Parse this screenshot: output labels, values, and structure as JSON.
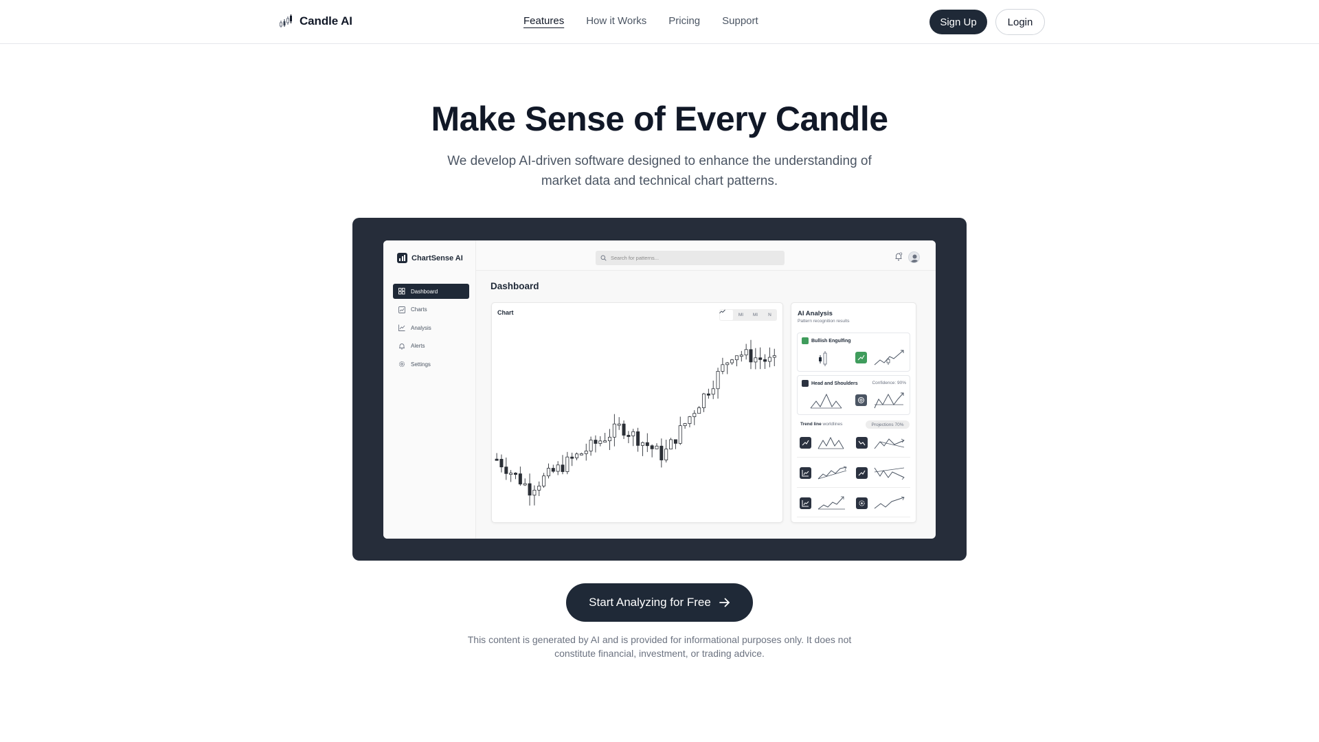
{
  "brand": {
    "name": "Candle AI",
    "icon": "candlestick-icon"
  },
  "nav": {
    "links": [
      "Features",
      "How it Works",
      "Pricing",
      "Support"
    ],
    "active": "Features",
    "signup_label": "Sign Up",
    "login_label": "Login"
  },
  "hero": {
    "title": "Make Sense of Every Candle",
    "subtitle": "We develop AI-driven software designed to enhance the understanding of market data and technical chart patterns."
  },
  "mockup": {
    "app_name": "ChartSense AI",
    "sidebar": [
      {
        "label": "Dashboard",
        "icon": "dashboard-icon",
        "active": true
      },
      {
        "label": "Charts",
        "icon": "chart-icon"
      },
      {
        "label": "Analysis",
        "icon": "analysis-icon"
      },
      {
        "label": "Alerts",
        "icon": "bell-icon"
      },
      {
        "label": "Settings",
        "icon": "gear-icon"
      }
    ],
    "search_placeholder": "Search for patterns...",
    "page_title": "Dashboard",
    "chart": {
      "label": "Chart",
      "timeframes": [
        "",
        "MI",
        "MI",
        "N"
      ]
    },
    "ai": {
      "title": "AI Analysis",
      "subtitle": "Pattern recognition results",
      "cards": [
        {
          "name": "Bullish Engulfing",
          "badge_color": "#3f9c5c"
        },
        {
          "name": "Head and Shoulders",
          "confidence": "Confidence: 90%"
        }
      ],
      "trend_label": "Trend line",
      "trend_sub": "worldlines",
      "projection": "Projections 70%"
    }
  },
  "cta": {
    "label": "Start Analyzing for Free",
    "icon": "arrow-right-icon"
  },
  "disclaimer": "This content is generated by AI and is provided for informational purposes only. It does not constitute financial, investment, or trading advice.",
  "colors": {
    "primary": "#1f2937",
    "text": "#111827",
    "muted": "#4b5563",
    "frame": "#262d3a",
    "accent_green": "#3f9c5c"
  }
}
